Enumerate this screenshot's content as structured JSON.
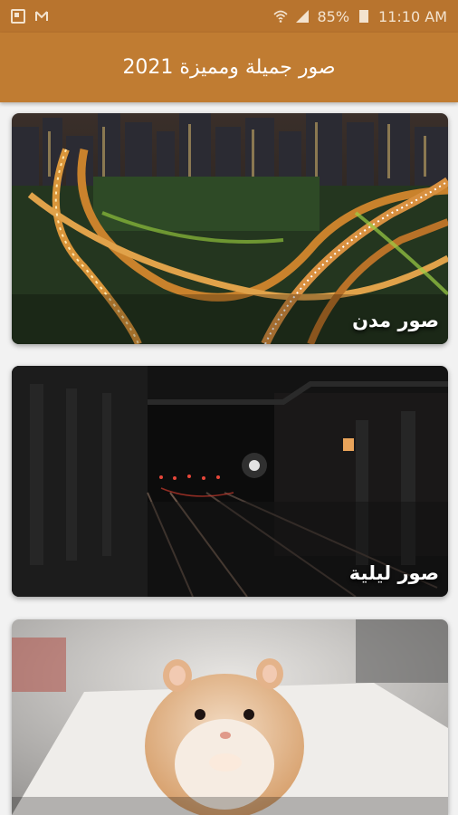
{
  "status_bar": {
    "battery": "85%",
    "time": "11:10 AM",
    "icons": [
      "gallery-notification-icon",
      "mail-notification-icon",
      "wifi-icon",
      "signal-icon",
      "battery-icon"
    ]
  },
  "app_bar": {
    "title": "صور جميلة ومميزة 2021"
  },
  "cards": [
    {
      "caption": "صور مدن",
      "image": "city-highway-night-photo"
    },
    {
      "caption": "صور ليلية",
      "image": "dark-railway-tunnel-photo"
    },
    {
      "caption": "",
      "image": "hamster-photo"
    }
  ],
  "colors": {
    "app_bar": "#c07c32",
    "status_bar": "#b8742e",
    "background": "#f2f2f2"
  }
}
